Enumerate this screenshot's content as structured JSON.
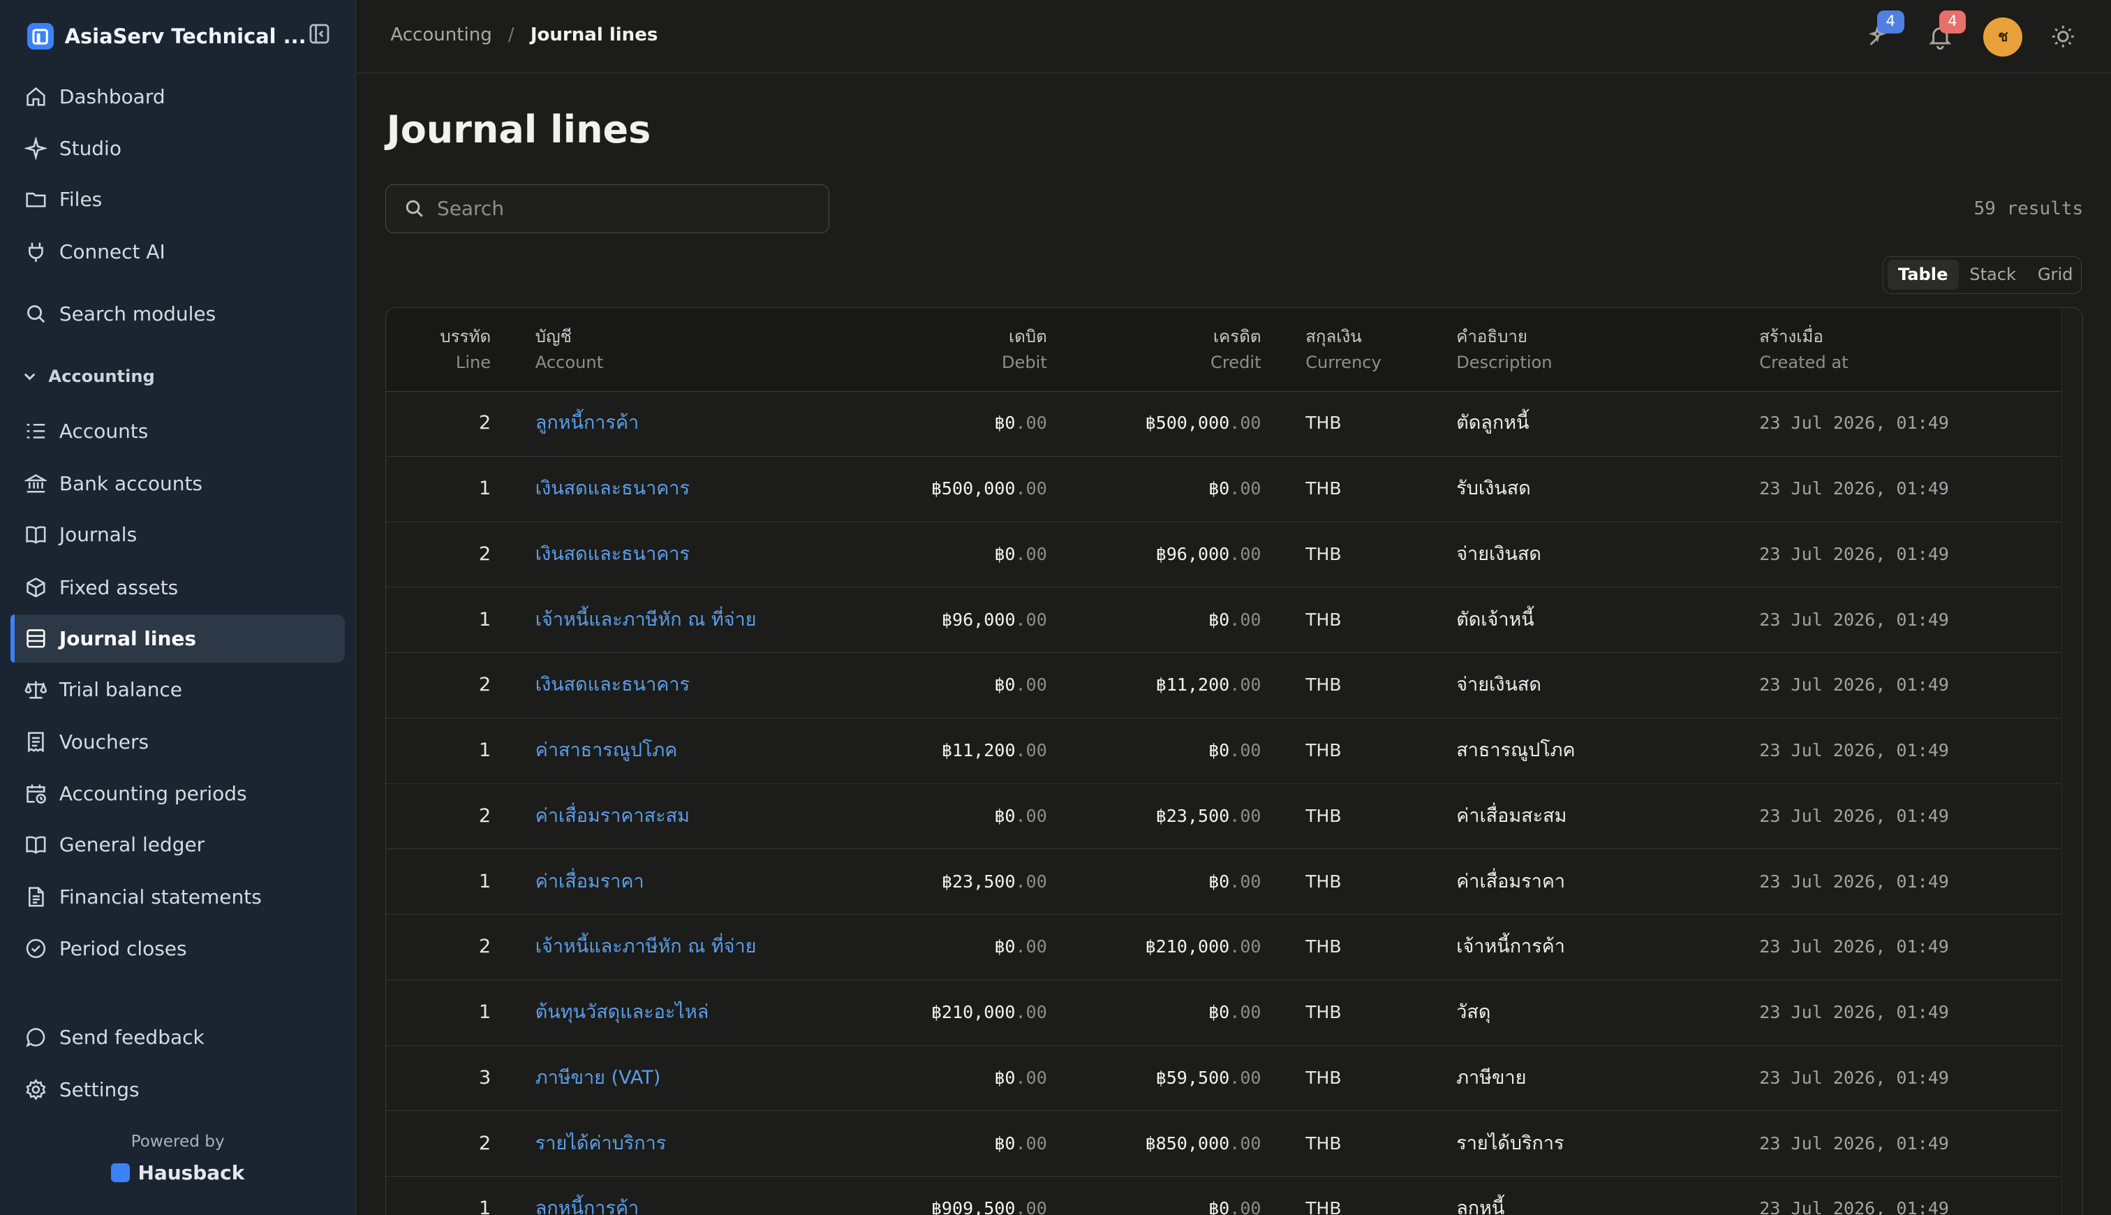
{
  "app": {
    "title": "AsiaServ Technical ..."
  },
  "sidebar": {
    "top_items": [
      {
        "label": "Dashboard",
        "icon": "home-icon"
      },
      {
        "label": "Studio",
        "icon": "sparkle-icon"
      },
      {
        "label": "Files",
        "icon": "folder-icon"
      },
      {
        "label": "Connect AI",
        "icon": "plug-icon"
      }
    ],
    "search_modules": "Search modules",
    "section": "Accounting",
    "items": [
      {
        "label": "Accounts",
        "icon": "list-icon"
      },
      {
        "label": "Bank accounts",
        "icon": "bank-icon"
      },
      {
        "label": "Journals",
        "icon": "book-icon"
      },
      {
        "label": "Fixed assets",
        "icon": "package-icon"
      },
      {
        "label": "Journal lines",
        "icon": "table-icon"
      },
      {
        "label": "Trial balance",
        "icon": "scale-icon"
      },
      {
        "label": "Vouchers",
        "icon": "receipt-icon"
      },
      {
        "label": "Accounting periods",
        "icon": "calendar-clock-icon"
      },
      {
        "label": "General ledger",
        "icon": "book-open-icon"
      },
      {
        "label": "Financial statements",
        "icon": "file-text-icon"
      },
      {
        "label": "Period closes",
        "icon": "check-circle-icon"
      }
    ],
    "bottom_items": [
      {
        "label": "Send feedback",
        "icon": "message-icon"
      },
      {
        "label": "Settings",
        "icon": "gear-icon"
      }
    ],
    "powered_by": "Powered by",
    "powered_brand": "Hausback"
  },
  "breadcrumb": {
    "parent": "Accounting",
    "separator": "/",
    "current": "Journal lines"
  },
  "topbar": {
    "assistant_badge": "4",
    "notifications_badge": "4",
    "avatar_initial": "ช"
  },
  "page": {
    "title": "Journal lines",
    "search_placeholder": "Search",
    "results": "59 results",
    "views": [
      "Table",
      "Stack",
      "Grid"
    ],
    "active_view": "Table"
  },
  "table": {
    "columns": [
      {
        "th": "บรรทัด",
        "en": "Line"
      },
      {
        "th": "บัญชี",
        "en": "Account"
      },
      {
        "th": "เดบิต",
        "en": "Debit"
      },
      {
        "th": "เครดิต",
        "en": "Credit"
      },
      {
        "th": "สกุลเงิน",
        "en": "Currency"
      },
      {
        "th": "คำอธิบาย",
        "en": "Description"
      },
      {
        "th": "สร้างเมื่อ",
        "en": "Created at"
      }
    ],
    "rows": [
      {
        "line": "2",
        "account": "ลูกหนี้การค้า",
        "debit": "฿0",
        "debit_frac": ".00",
        "credit": "฿500,000",
        "credit_frac": ".00",
        "currency": "THB",
        "description": "ตัดลูกหนี้",
        "created": "23 Jul 2026, 01:49"
      },
      {
        "line": "1",
        "account": "เงินสดและธนาคาร",
        "debit": "฿500,000",
        "debit_frac": ".00",
        "credit": "฿0",
        "credit_frac": ".00",
        "currency": "THB",
        "description": "รับเงินสด",
        "created": "23 Jul 2026, 01:49"
      },
      {
        "line": "2",
        "account": "เงินสดและธนาคาร",
        "debit": "฿0",
        "debit_frac": ".00",
        "credit": "฿96,000",
        "credit_frac": ".00",
        "currency": "THB",
        "description": "จ่ายเงินสด",
        "created": "23 Jul 2026, 01:49"
      },
      {
        "line": "1",
        "account": "เจ้าหนี้และภาษีหัก ณ ที่จ่าย",
        "debit": "฿96,000",
        "debit_frac": ".00",
        "credit": "฿0",
        "credit_frac": ".00",
        "currency": "THB",
        "description": "ตัดเจ้าหนี้",
        "created": "23 Jul 2026, 01:49"
      },
      {
        "line": "2",
        "account": "เงินสดและธนาคาร",
        "debit": "฿0",
        "debit_frac": ".00",
        "credit": "฿11,200",
        "credit_frac": ".00",
        "currency": "THB",
        "description": "จ่ายเงินสด",
        "created": "23 Jul 2026, 01:49"
      },
      {
        "line": "1",
        "account": "ค่าสาธารณูปโภค",
        "debit": "฿11,200",
        "debit_frac": ".00",
        "credit": "฿0",
        "credit_frac": ".00",
        "currency": "THB",
        "description": "สาธารณูปโภค",
        "created": "23 Jul 2026, 01:49"
      },
      {
        "line": "2",
        "account": "ค่าเสื่อมราคาสะสม",
        "debit": "฿0",
        "debit_frac": ".00",
        "credit": "฿23,500",
        "credit_frac": ".00",
        "currency": "THB",
        "description": "ค่าเสื่อมสะสม",
        "created": "23 Jul 2026, 01:49"
      },
      {
        "line": "1",
        "account": "ค่าเสื่อมราคา",
        "debit": "฿23,500",
        "debit_frac": ".00",
        "credit": "฿0",
        "credit_frac": ".00",
        "currency": "THB",
        "description": "ค่าเสื่อมราคา",
        "created": "23 Jul 2026, 01:49"
      },
      {
        "line": "2",
        "account": "เจ้าหนี้และภาษีหัก ณ ที่จ่าย",
        "debit": "฿0",
        "debit_frac": ".00",
        "credit": "฿210,000",
        "credit_frac": ".00",
        "currency": "THB",
        "description": "เจ้าหนี้การค้า",
        "created": "23 Jul 2026, 01:49"
      },
      {
        "line": "1",
        "account": "ต้นทุนวัสดุและอะไหล่",
        "debit": "฿210,000",
        "debit_frac": ".00",
        "credit": "฿0",
        "credit_frac": ".00",
        "currency": "THB",
        "description": "วัสดุ",
        "created": "23 Jul 2026, 01:49"
      },
      {
        "line": "3",
        "account": "ภาษีขาย (VAT)",
        "debit": "฿0",
        "debit_frac": ".00",
        "credit": "฿59,500",
        "credit_frac": ".00",
        "currency": "THB",
        "description": "ภาษีขาย",
        "created": "23 Jul 2026, 01:49"
      },
      {
        "line": "2",
        "account": "รายได้ค่าบริการ",
        "debit": "฿0",
        "debit_frac": ".00",
        "credit": "฿850,000",
        "credit_frac": ".00",
        "currency": "THB",
        "description": "รายได้บริการ",
        "created": "23 Jul 2026, 01:49"
      },
      {
        "line": "1",
        "account": "ลูกหนี้การค้า",
        "debit": "฿909,500",
        "debit_frac": ".00",
        "credit": "฿0",
        "credit_frac": ".00",
        "currency": "THB",
        "description": "ลูกหนี้",
        "created": "23 Jul 2026, 01:49"
      }
    ]
  },
  "colors": {
    "accent": "#3b82f6",
    "link": "#5b9ee9",
    "sidebar_bg": "#1b2431",
    "content_bg": "#1c1c1a",
    "avatar": "#e9a23b",
    "badge_blue": "#4f7fe0",
    "badge_red": "#e8706a"
  }
}
